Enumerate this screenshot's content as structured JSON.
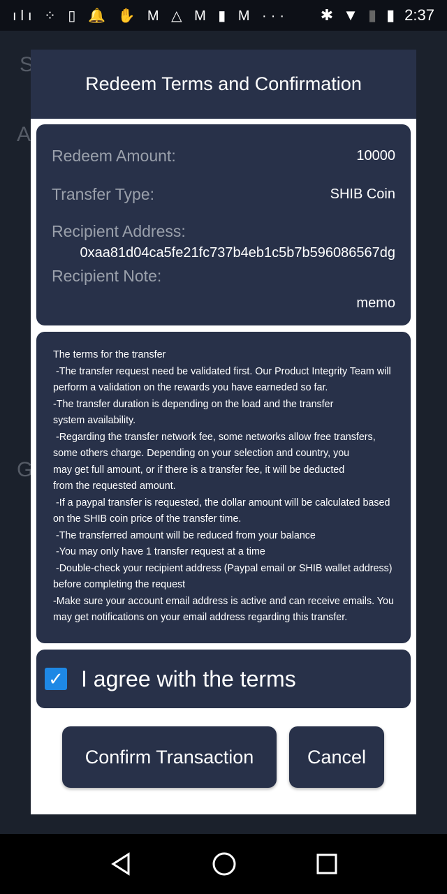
{
  "status_bar": {
    "time": "2:37",
    "notification_icons": [
      "soundwave-icon",
      "dots-icon",
      "phone-sync-icon",
      "bell-icon",
      "hand-wave-icon",
      "gmail-icon",
      "drive-icon",
      "gmail-icon",
      "keyhole-icon",
      "gmail-icon",
      "more-icon"
    ],
    "system_icons": [
      "bluetooth-icon",
      "wifi-icon",
      "no-sim-icon",
      "battery-charging-icon"
    ]
  },
  "background": {
    "letters": [
      "S",
      "A",
      "G"
    ]
  },
  "dialog": {
    "title": "Redeem Terms and Confirmation",
    "redeem_amount_label": "Redeem Amount:",
    "redeem_amount": "10000",
    "transfer_type_label": "Transfer Type:",
    "transfer_type": "SHIB Coin",
    "recipient_address_label": "Recipient Address:",
    "recipient_address": "0xaa81d04ca5fe21fc737b4eb1c5b7b596086567dg",
    "recipient_note_label": "Recipient Note:",
    "recipient_note": "memo",
    "terms_lines": [
      "The terms for the transfer",
      " -The transfer request need be validated first. Our Product Integrity Team will",
      "perform a validation on the rewards you have earneded so far.",
      "-The transfer duration is depending on the load and the transfer",
      "system availability.",
      " -Regarding the transfer network fee, some networks allow free transfers,",
      "some others charge. Depending on your selection and country, you",
      "may get full amount, or if there is a transfer fee, it will be deducted",
      "from the requested amount.",
      " -If a paypal transfer is requested, the dollar amount will be calculated based",
      "on the SHIB coin price of the transfer time.",
      " -The transferred amount will be reduced from your balance",
      " -You may only have 1 transfer request at a time",
      " -Double-check your recipient address (Paypal email or SHIB wallet address)",
      "before completing the request",
      "-Make sure your account email address is active and can receive emails. You",
      "may get notifications on your email address regarding this transfer."
    ],
    "agree_label": "I agree with the terms",
    "agree_checked": true,
    "confirm_label": "Confirm Transaction",
    "cancel_label": "Cancel"
  },
  "colors": {
    "card": "#283149",
    "checkbox": "#1e88e5"
  }
}
